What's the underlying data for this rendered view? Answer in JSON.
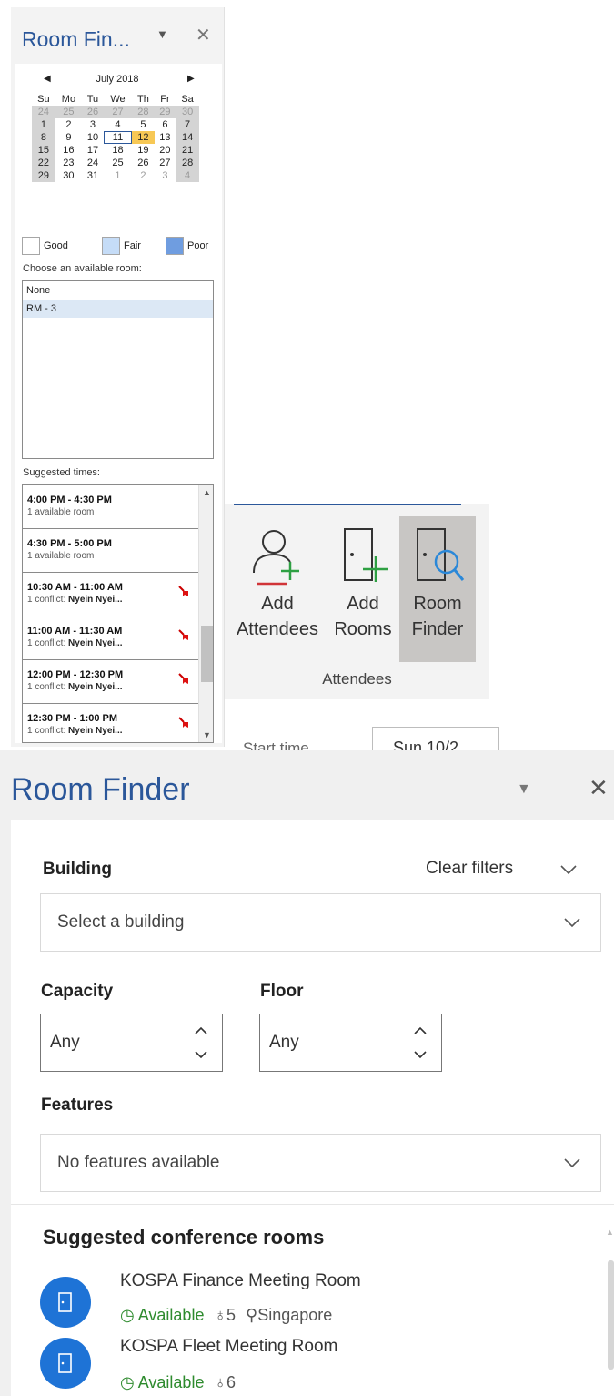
{
  "old_pane": {
    "title": "Room Fin...",
    "dropdown_glyph": "▼",
    "close_glyph": "✕",
    "calendar": {
      "month_label": "July 2018",
      "prev_glyph": "◀",
      "next_glyph": "▶",
      "weekdays": [
        "Su",
        "Mo",
        "Tu",
        "We",
        "Th",
        "Fr",
        "Sa"
      ],
      "weeks": [
        [
          "24",
          "25",
          "26",
          "27",
          "28",
          "29",
          "30"
        ],
        [
          "1",
          "2",
          "3",
          "4",
          "5",
          "6",
          "7"
        ],
        [
          "8",
          "9",
          "10",
          "11",
          "12",
          "13",
          "14"
        ],
        [
          "15",
          "16",
          "17",
          "18",
          "19",
          "20",
          "21"
        ],
        [
          "22",
          "23",
          "24",
          "25",
          "26",
          "27",
          "28"
        ],
        [
          "29",
          "30",
          "31",
          "1",
          "2",
          "3",
          "4"
        ]
      ],
      "today": "11",
      "selected": "12"
    },
    "legend": {
      "good": "Good",
      "fair": "Fair",
      "poor": "Poor",
      "good_color": "#ffffff",
      "fair_color": "#c5dcf7",
      "poor_color": "#6f9de0"
    },
    "room_label": "Choose an available room:",
    "rooms": [
      "None",
      "RM - 3"
    ],
    "times_label": "Suggested times:",
    "times": [
      {
        "range": "4:00 PM - 4:30 PM",
        "sub": "1 available room",
        "conflict_name": ""
      },
      {
        "range": "4:30 PM - 5:00 PM",
        "sub": "1 available room",
        "conflict_name": ""
      },
      {
        "range": "10:30 AM - 11:00 AM",
        "sub": "1 conflict: ",
        "conflict_name": "Nyein Nyei..."
      },
      {
        "range": "11:00 AM - 11:30 AM",
        "sub": "1 conflict: ",
        "conflict_name": "Nyein Nyei..."
      },
      {
        "range": "12:00 PM - 12:30 PM",
        "sub": "1 conflict: ",
        "conflict_name": "Nyein Nyei..."
      },
      {
        "range": "12:30 PM - 1:00 PM",
        "sub": "1 conflict: ",
        "conflict_name": "Nyein Nyei..."
      }
    ]
  },
  "ribbon": {
    "buttons": [
      {
        "line1": "Add",
        "line2": "Attendees",
        "icon": "add-attendees-icon"
      },
      {
        "line1": "Add",
        "line2": "Rooms",
        "icon": "add-rooms-icon"
      },
      {
        "line1": "Room",
        "line2": "Finder",
        "icon": "room-finder-icon",
        "active": true
      }
    ],
    "group_label": "Attendees",
    "start_time_label": "Start time",
    "start_time_value": "Sun 10/2..."
  },
  "new_pane": {
    "title": "Room Finder",
    "dropdown_glyph": "▼",
    "close_glyph": "✕",
    "building_label": "Building",
    "clear_filters": "Clear filters",
    "building_placeholder": "Select a building",
    "capacity_label": "Capacity",
    "capacity_value": "Any",
    "floor_label": "Floor",
    "floor_value": "Any",
    "features_label": "Features",
    "features_placeholder": "No features available",
    "suggested_title": "Suggested conference rooms",
    "rooms": [
      {
        "name": "KOSPA Finance Meeting Room",
        "status": "Available",
        "capacity": "5",
        "location": "Singapore"
      },
      {
        "name": "KOSPA Fleet Meeting Room",
        "status": "Available",
        "capacity": "6",
        "location": ""
      }
    ],
    "accent_color": "#2b579a",
    "available_color": "#2e8b2e",
    "avatar_color": "#1e73d6"
  }
}
